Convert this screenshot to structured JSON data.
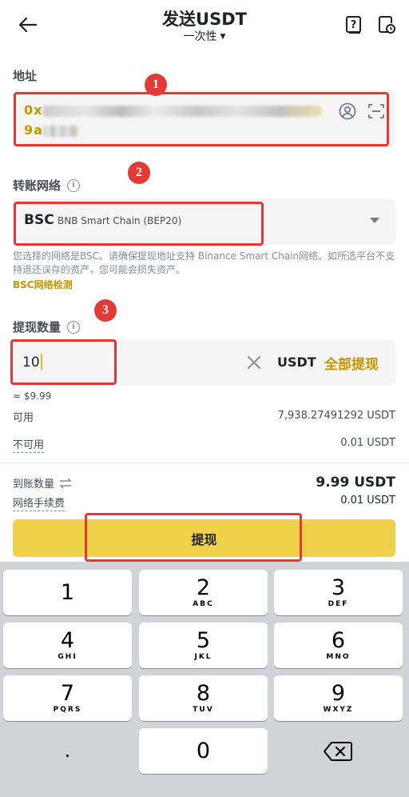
{
  "header": {
    "title": "发送USDT",
    "mode": "一次性"
  },
  "address": {
    "label": "地址",
    "line1_prefix": "0x",
    "line2_prefix": "9a"
  },
  "network": {
    "label": "转账网络",
    "code": "BSC",
    "name": "BNB Smart Chain (BEP20)",
    "note": "您选择的网络是BSC。请确保提现地址支持 Binance Smart Chain网络。如所选平台不支持退还误存的资产，您可能会损失资产。",
    "check_link": "BSC网络检测"
  },
  "amount": {
    "label": "提现数量",
    "value": "10",
    "unit": "USDT",
    "max_label": "全部提现",
    "approx": "≈ $9.99",
    "available_label": "可用",
    "available_value": "7,938.27491292 USDT",
    "unavailable_label": "不可用",
    "unavailable_value": "0.01 USDT"
  },
  "summary": {
    "receive_label": "到账数量",
    "receive_value": "9.99 USDT",
    "fee_label": "网络手续费",
    "fee_value": "0.01 USDT"
  },
  "withdraw_button": "提现",
  "keypad": {
    "keys": [
      {
        "digit": "1",
        "letters": ""
      },
      {
        "digit": "2",
        "letters": "ABC"
      },
      {
        "digit": "3",
        "letters": "DEF"
      },
      {
        "digit": "4",
        "letters": "GHI"
      },
      {
        "digit": "5",
        "letters": "JKL"
      },
      {
        "digit": "6",
        "letters": "MNO"
      },
      {
        "digit": "7",
        "letters": "PQRS"
      },
      {
        "digit": "8",
        "letters": "TUV"
      },
      {
        "digit": "9",
        "letters": "WXYZ"
      },
      {
        "digit": ".",
        "letters": ""
      },
      {
        "digit": "0",
        "letters": ""
      }
    ]
  },
  "annotations": [
    "1",
    "2",
    "3"
  ],
  "colors": {
    "accent": "#c99400",
    "button": "#f0d24a",
    "annotation": "#e53935"
  }
}
